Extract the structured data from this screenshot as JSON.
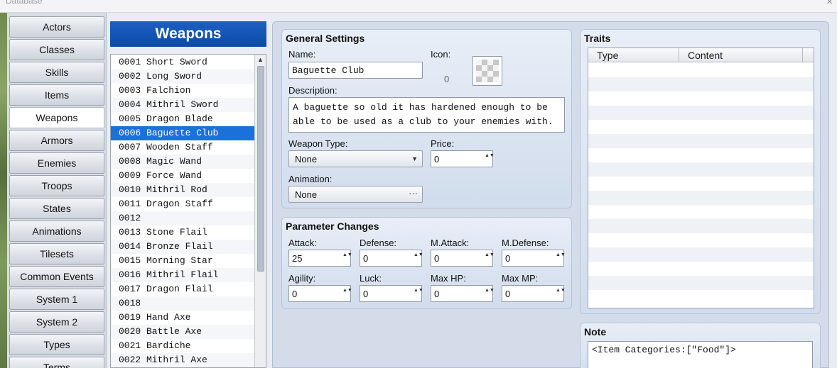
{
  "window": {
    "title": "Database",
    "close_glyph": "×"
  },
  "categories": [
    {
      "label": "Actors"
    },
    {
      "label": "Classes"
    },
    {
      "label": "Skills"
    },
    {
      "label": "Items"
    },
    {
      "label": "Weapons",
      "active": true
    },
    {
      "label": "Armors"
    },
    {
      "label": "Enemies"
    },
    {
      "label": "Troops"
    },
    {
      "label": "States"
    },
    {
      "label": "Animations"
    },
    {
      "label": "Tilesets"
    },
    {
      "label": "Common Events"
    },
    {
      "label": "System 1"
    },
    {
      "label": "System 2"
    },
    {
      "label": "Types"
    },
    {
      "label": "Terms"
    }
  ],
  "list": {
    "header": "Weapons",
    "selected_index": 5,
    "items": [
      "0001 Short Sword",
      "0002 Long Sword",
      "0003 Falchion",
      "0004 Mithril Sword",
      "0005 Dragon Blade",
      "0006 Baguette Club",
      "0007 Wooden Staff",
      "0008 Magic Wand",
      "0009 Force Wand",
      "0010 Mithril Rod",
      "0011 Dragon Staff",
      "0012",
      "0013 Stone Flail",
      "0014 Bronze Flail",
      "0015 Morning Star",
      "0016 Mithril Flail",
      "0017 Dragon Flail",
      "0018",
      "0019 Hand Axe",
      "0020 Battle Axe",
      "0021 Bardiche",
      "0022 Mithril Axe"
    ],
    "scroll_up_glyph": "▲"
  },
  "general": {
    "title": "General Settings",
    "name_label": "Name:",
    "name_value": "Baguette Club",
    "icon_label": "Icon:",
    "icon_index": "0",
    "description_label": "Description:",
    "description_value": "A baguette so old it has hardened enough to be able to be used as a club to your enemies with.",
    "weapon_type_label": "Weapon Type:",
    "weapon_type_value": "None",
    "price_label": "Price:",
    "price_value": "0",
    "animation_label": "Animation:",
    "animation_value": "None",
    "dropdown_arrow": "▼",
    "ellipsis": "···",
    "spin_arrows": "▲▼"
  },
  "params": {
    "title": "Parameter Changes",
    "fields": [
      {
        "label": "Attack:",
        "value": "25"
      },
      {
        "label": "Defense:",
        "value": "0"
      },
      {
        "label": "M.Attack:",
        "value": "0"
      },
      {
        "label": "M.Defense:",
        "value": "0"
      },
      {
        "label": "Agility:",
        "value": "0"
      },
      {
        "label": "Luck:",
        "value": "0"
      },
      {
        "label": "Max HP:",
        "value": "0"
      },
      {
        "label": "Max MP:",
        "value": "0"
      }
    ]
  },
  "traits": {
    "title": "Traits",
    "col_type": "Type",
    "col_content": "Content"
  },
  "note": {
    "title": "Note",
    "value": "<Item Categories:[\"Food\"]>"
  }
}
